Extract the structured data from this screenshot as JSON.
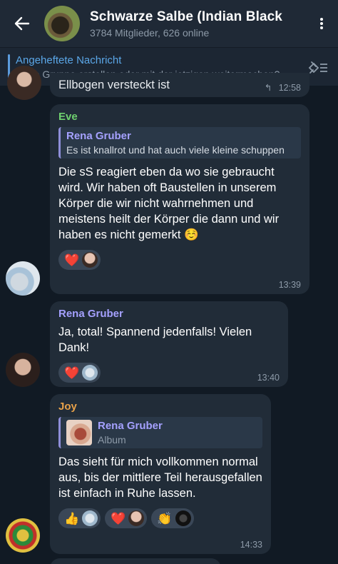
{
  "header": {
    "title": "Schwarze Salbe (Indian Black",
    "subtitle": "3784 Mitglieder, 626 online"
  },
  "pinned": {
    "title": "Angeheftete Nachricht",
    "message": "Neue Gruppe erstellen oder mit der jetzigen weitermachen?"
  },
  "partial_message": {
    "text": "Ellbogen versteckt ist",
    "time": "12:58"
  },
  "messages": [
    {
      "sender": "Eve",
      "sender_color": "#6fd16f",
      "reply_name": "Rena Gruber",
      "reply_text": "Es ist knallrot und hat auch viele kleine schuppen",
      "text": "Die sS reagiert eben da wo sie gebraucht wird. Wir haben oft Baustellen in unserem Körper die wir nicht wahrnehmen und meistens heilt der Körper die dann und wir haben es nicht gemerkt ☺️",
      "reaction": "❤️",
      "time": "13:39"
    },
    {
      "sender": "Rena Gruber",
      "sender_color": "#a5a1ff",
      "text": "Ja, total! Spannend jedenfalls! Vielen Dank!",
      "reaction": "❤️",
      "time": "13:40"
    },
    {
      "sender": "Joy",
      "sender_color": "#e8a24a",
      "reply_name": "Rena Gruber",
      "reply_text": "Album",
      "text": "Das sieht für mich vollkommen normal aus, bis der mittlere Teil herausgefallen ist einfach in Ruhe lassen.",
      "reactions": [
        "👍",
        "❤️",
        "👏"
      ],
      "time": "14:33"
    }
  ]
}
